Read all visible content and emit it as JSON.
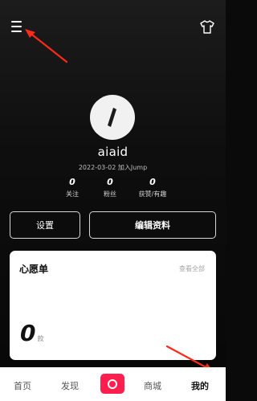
{
  "profile": {
    "username": "aiaid",
    "join_date": "2022-03-02 加入Jump",
    "stats": [
      {
        "value": "0",
        "label": "关注"
      },
      {
        "value": "0",
        "label": "粉丝"
      },
      {
        "value": "0",
        "label": "获赞/有趣"
      }
    ]
  },
  "actions": {
    "settings_label": "设置",
    "edit_label": "编辑资料"
  },
  "wishlist": {
    "title": "心愿单",
    "view_all": "查看全部",
    "count": "0",
    "unit": "款"
  },
  "tabbar": {
    "home": "首页",
    "discover": "发现",
    "shop": "商城",
    "mine": "我的",
    "active": "mine"
  },
  "icons": {
    "menu": "menu-icon",
    "shirt": "tshirt-icon",
    "avatar": "default-avatar-icon",
    "center": "record-icon"
  },
  "colors": {
    "background": "#0a0a0a",
    "accent": "#ff1f4f",
    "annotation": "#ff2a1a"
  }
}
